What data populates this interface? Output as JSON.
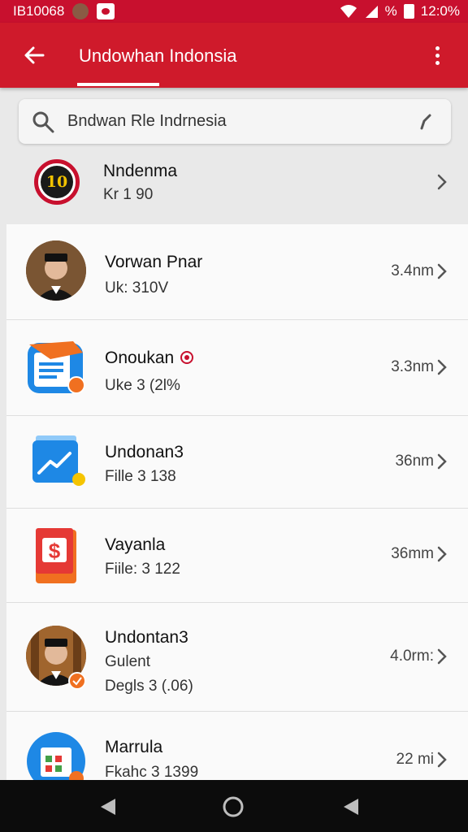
{
  "status_bar": {
    "left_text": "IB10068",
    "battery_text": "%",
    "time": "12:0%"
  },
  "app_bar": {
    "title": "Undowhan Indonsia"
  },
  "search": {
    "value": "Bndwan Rle Indrnesia"
  },
  "header_item": {
    "logo_text": "10",
    "name": "Nndenma",
    "subtitle": "Kr 1 90"
  },
  "items": [
    {
      "title": "Vorwan Pnar",
      "subtitle": "Uk: 310V",
      "size": "3.4nm",
      "icon": "avatar-man-icon"
    },
    {
      "title": "Onoukan",
      "subtitle": "Uke 3 (2l%",
      "size": "3.3nm",
      "icon": "document-app-icon"
    },
    {
      "title": "Undonan3",
      "subtitle": "Fille 3 138",
      "size": "36nm",
      "icon": "chart-app-icon"
    },
    {
      "title": "Vayanla",
      "subtitle": "Fiile: 3 122",
      "size": "36mm",
      "icon": "dollar-app-icon"
    },
    {
      "title": "Undontan3",
      "subtitle": "Gulent",
      "subtitle2": "Degls 3 (.06)",
      "size": "4.0rm:",
      "icon": "avatar-man-icon"
    },
    {
      "title": "Marrula",
      "subtitle": "Fkahc 3 1399",
      "size": "22 mi",
      "icon": "spreadsheet-app-icon"
    }
  ],
  "colors": {
    "brand_red": "#cf1a2b",
    "status_red": "#c8102e",
    "accent_orange": "#f07020",
    "accent_blue": "#1e88e5"
  }
}
